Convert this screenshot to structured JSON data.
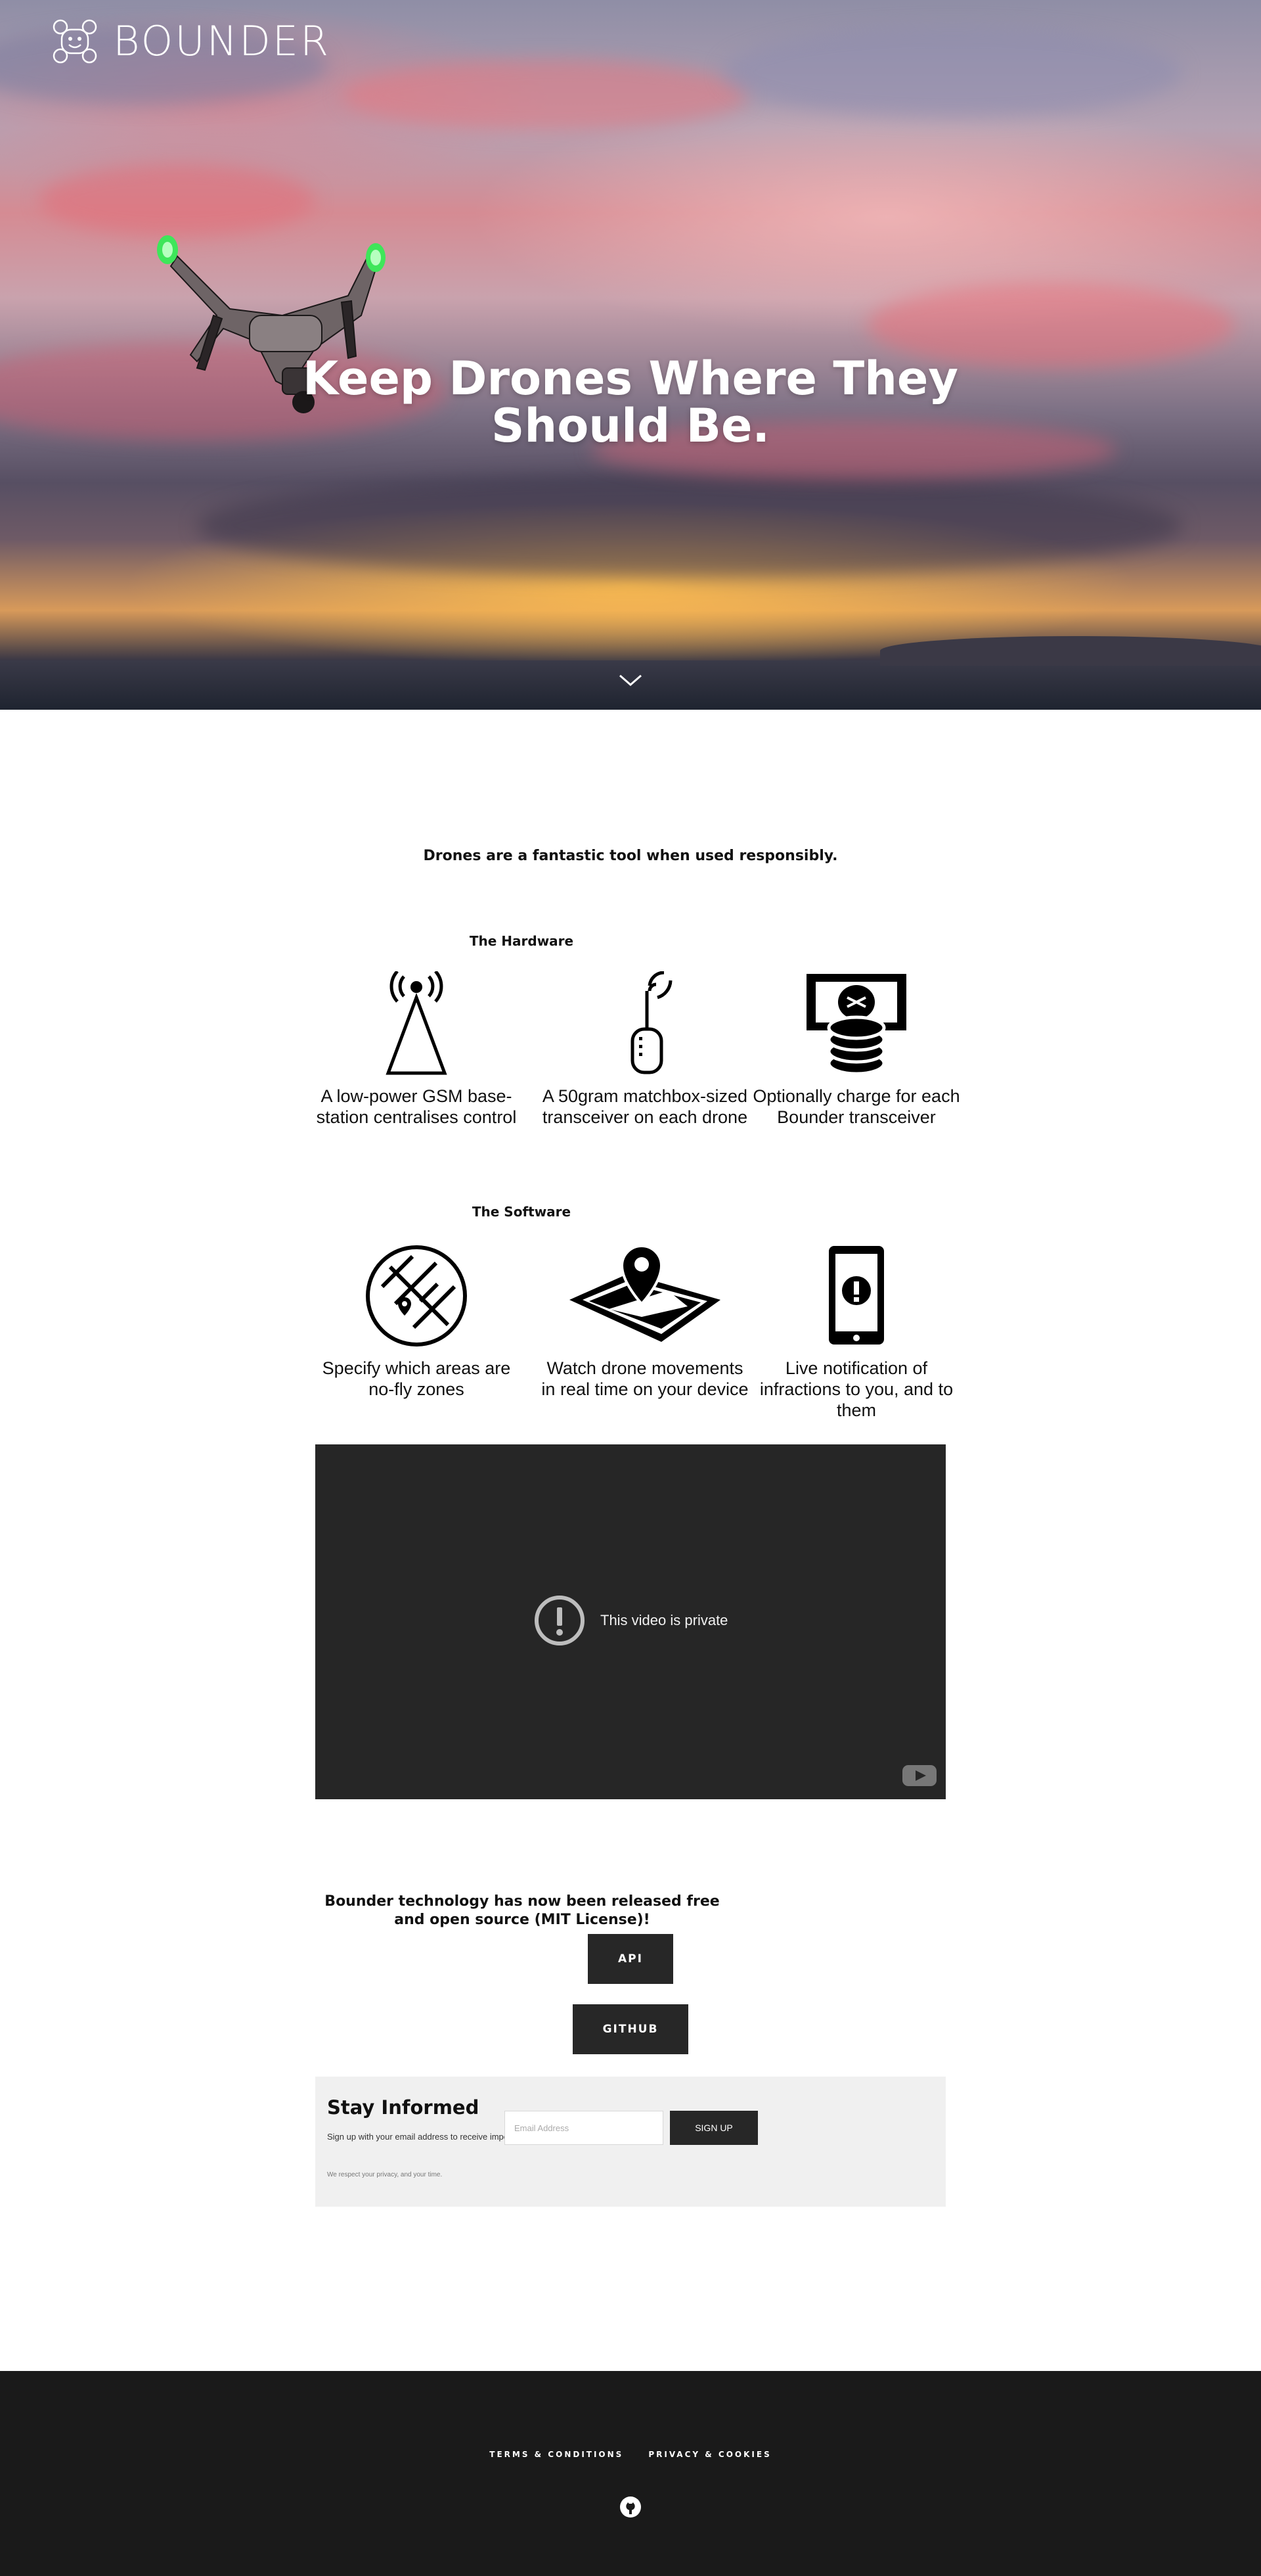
{
  "brand": {
    "name": "BOUNDER",
    "logo_icon": "drone-face-logo"
  },
  "hero": {
    "title": "Keep Drones Where They Should Be.",
    "scroll_icon": "chevron-down-icon",
    "sky_accent": "#d8808a",
    "sunset_accent": "#ffbd5a"
  },
  "intro": {
    "text": "Drones are a fantastic tool when used responsibly."
  },
  "hardware": {
    "heading": "The Hardware",
    "items": [
      {
        "icon": "antenna-tower-icon",
        "text": "A low-power GSM base-station centralises control"
      },
      {
        "icon": "transceiver-icon",
        "text": "A 50gram matchbox-sized transceiver on each drone"
      },
      {
        "icon": "money-coins-icon",
        "text": "Optionally charge for each Bounder transceiver"
      }
    ]
  },
  "software": {
    "heading": "The Software",
    "items": [
      {
        "icon": "no-fly-zone-icon",
        "text": "Specify which areas are no-fly zones"
      },
      {
        "icon": "map-pin-icon",
        "text": "Watch drone movements in real time on your device"
      },
      {
        "icon": "phone-alert-icon",
        "text": "Live notification of infractions to you, and to them"
      }
    ]
  },
  "video": {
    "message": "This video is private",
    "background": "#262626"
  },
  "release": {
    "text": "Bounder technology has now been released free and open source (MIT License)!",
    "api_label": "API",
    "github_label": "GITHUB"
  },
  "newsletter": {
    "title": "Stay Informed",
    "subtitle": "Sign up with your email address to receive important updates.",
    "email_placeholder": "Email Address",
    "submit_label": "SIGN UP",
    "privacy": "We respect your privacy, and your time."
  },
  "footer": {
    "links": [
      "TERMS & CONDITIONS",
      "PRIVACY & COOKIES"
    ],
    "social_icon": "github-icon",
    "background": "#1a1a1a"
  }
}
